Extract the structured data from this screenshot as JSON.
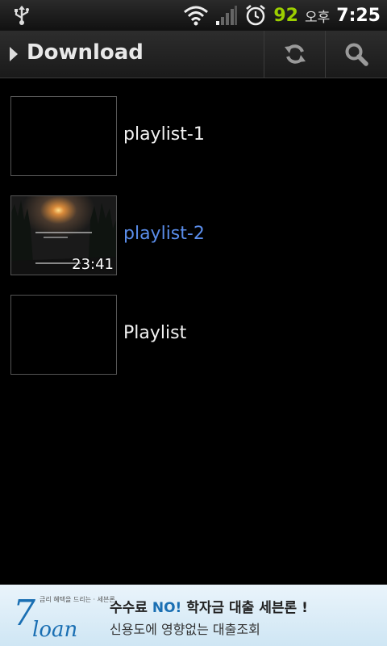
{
  "status_bar": {
    "battery": "92",
    "ampm": "오후",
    "time": "7:25",
    "icons": [
      "usb-icon",
      "wifi-icon",
      "signal-icon",
      "alarm-icon"
    ]
  },
  "titlebar": {
    "title": "Download",
    "refresh_icon": "refresh-icon",
    "search_icon": "search-icon"
  },
  "list": {
    "items": [
      {
        "label": "playlist-1",
        "duration": "",
        "selected": false
      },
      {
        "label": "playlist-2",
        "duration": "23:41",
        "selected": true
      },
      {
        "label": "Playlist",
        "duration": "",
        "selected": false
      }
    ]
  },
  "ad": {
    "logo_text": "loan",
    "logo_number": "7",
    "tagline": "금리 혜택을 드리는 · 세븐론",
    "line1_part1": "수수료 ",
    "line1_no": "NO!",
    "line1_part2": " 학자금 대출 ",
    "line1_brand": "세븐론 !",
    "line2": "신용도에 영향없는 대출조회"
  },
  "colors": {
    "battery": "#9ccf00",
    "selected_label": "#5a8dea",
    "background": "#000000"
  }
}
